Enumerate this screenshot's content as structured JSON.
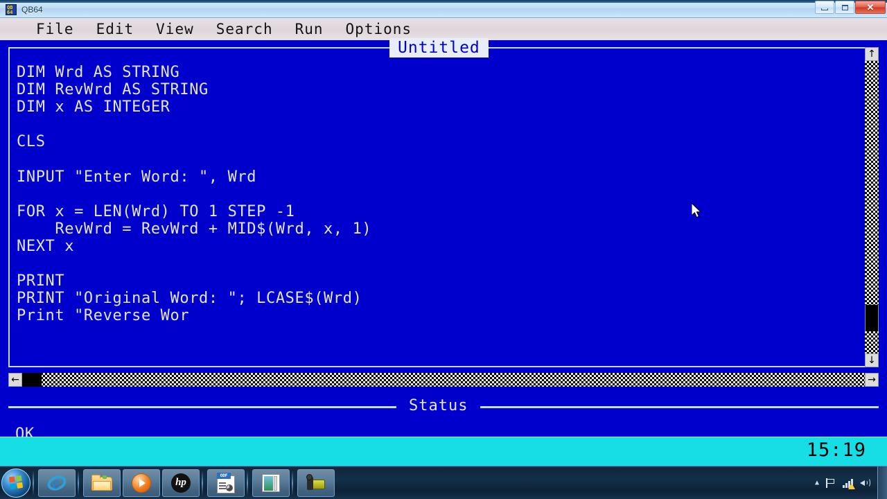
{
  "window": {
    "title": "QB64",
    "icon": "qb64-icon",
    "controls": {
      "minimize": "minimize-button",
      "maximize": "maximize-button",
      "close_glyph": "✕"
    }
  },
  "menubar": {
    "items": [
      {
        "label": "File"
      },
      {
        "label": "Edit"
      },
      {
        "label": "View"
      },
      {
        "label": "Search"
      },
      {
        "label": "Run"
      },
      {
        "label": "Options"
      }
    ]
  },
  "editor": {
    "title": "Untitled",
    "code_lines": [
      "DIM Wrd AS STRING",
      "DIM RevWrd AS STRING",
      "DIM x AS INTEGER",
      "",
      "CLS",
      "",
      "INPUT \"Enter Word: \", Wrd",
      "",
      "FOR x = LEN(Wrd) TO 1 STEP -1",
      "    RevWrd = RevWrd + MID$(Wrd, x, 1)",
      "NEXT x",
      "",
      "PRINT",
      "PRINT \"Original Word: \"; LCASE$(Wrd)",
      "Print \"Reverse Wor"
    ],
    "vscroll": {
      "up_glyph": "↑",
      "down_glyph": "↓"
    },
    "hscroll": {
      "left_glyph": "←",
      "right_glyph": "→"
    }
  },
  "status": {
    "label": "Status",
    "text": "OK"
  },
  "taskbar_strip": {
    "clock": "15:19"
  },
  "taskbar": {
    "start_label": "start-orb",
    "buttons": [
      {
        "name": "internet-explorer",
        "label": "Internet Explorer"
      },
      {
        "name": "windows-explorer",
        "label": "Windows Explorer"
      },
      {
        "name": "windows-media-player",
        "label": "Windows Media Player"
      },
      {
        "name": "hp-app",
        "label": "HP"
      },
      {
        "name": "odf-document",
        "label": "ODF Document",
        "badge": "ODF"
      },
      {
        "name": "qb64-window",
        "label": "QB64"
      },
      {
        "name": "camera-app",
        "label": "Camera"
      }
    ],
    "tray": [
      {
        "name": "show-hidden-icons",
        "glyph": "▲"
      },
      {
        "name": "action-center-flag"
      },
      {
        "name": "network-warning"
      },
      {
        "name": "volume"
      }
    ]
  },
  "colors": {
    "qb_blue": "#0000cc",
    "cyan_bar": "#17dee5",
    "menu_bg": "#e0d9dd",
    "code_text": "#e4e4e4",
    "frame": "#c8d8f0"
  }
}
